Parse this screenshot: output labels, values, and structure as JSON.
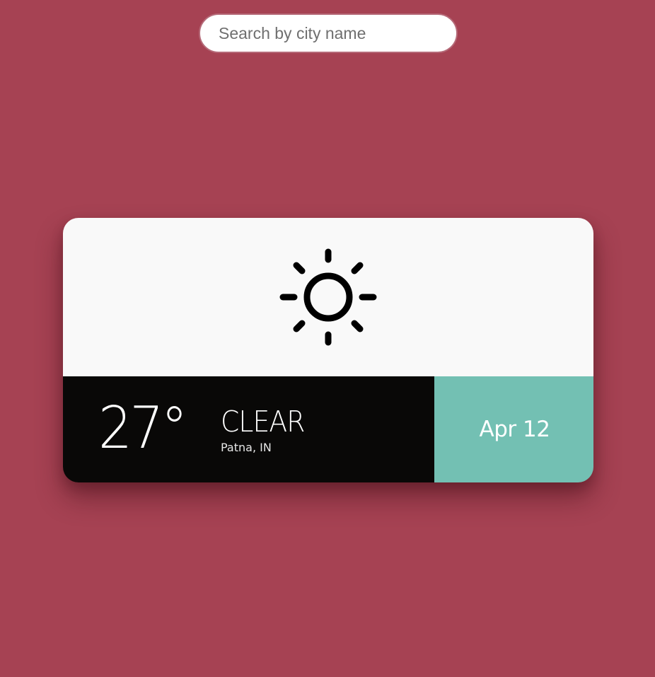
{
  "search": {
    "placeholder": "Search by city name",
    "value": ""
  },
  "weather": {
    "icon": "sun-icon",
    "temperature": "27°",
    "condition": "CLEAR",
    "location": "Patna, IN",
    "date": "Apr 12"
  },
  "colors": {
    "background": "#a64253",
    "card_top": "#f9f9f9",
    "info_panel": "#090807",
    "date_panel": "#73c0b3"
  }
}
